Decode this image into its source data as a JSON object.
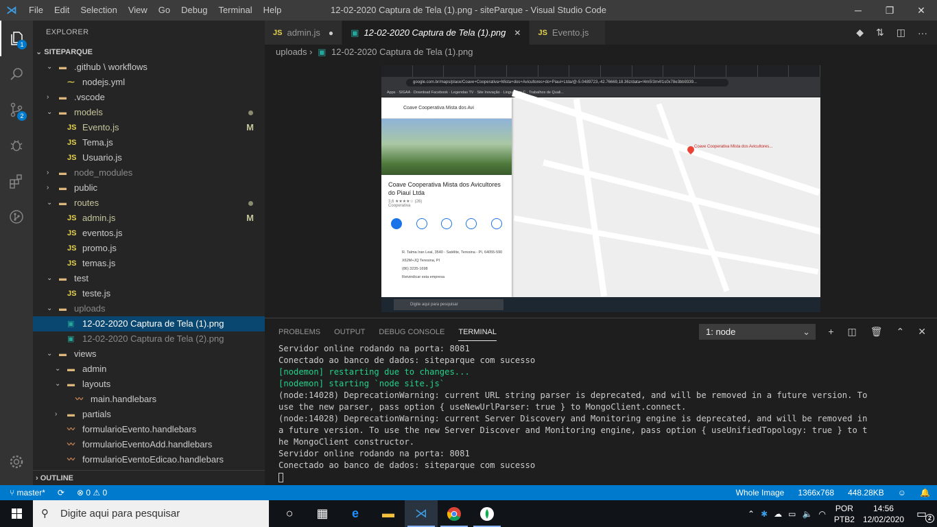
{
  "titlebar": {
    "menu": [
      "File",
      "Edit",
      "Selection",
      "View",
      "Go",
      "Debug",
      "Terminal",
      "Help"
    ],
    "title": "12-02-2020 Captura de Tela (1).png - siteParque - Visual Studio Code",
    "controls": [
      "minimize-icon",
      "restore-icon",
      "close-icon"
    ]
  },
  "activity_bar": {
    "items": [
      {
        "name": "explorer-icon",
        "badge": "1"
      },
      {
        "name": "search-icon",
        "badge": ""
      },
      {
        "name": "source-control-icon",
        "badge": "2"
      },
      {
        "name": "debug-icon",
        "badge": ""
      },
      {
        "name": "extensions-icon",
        "badge": ""
      },
      {
        "name": "git-graph-icon",
        "badge": ""
      }
    ],
    "settings_icon": "gear-icon"
  },
  "sidebar": {
    "header": "EXPLORER",
    "project": "SITEPARQUE",
    "tree": [
      {
        "label": ".github \\ workflows",
        "depth": 1,
        "type": "folder",
        "expanded": true
      },
      {
        "label": "nodejs.yml",
        "depth": 2,
        "type": "yml"
      },
      {
        "label": ".vscode",
        "depth": 1,
        "type": "folder",
        "expanded": false
      },
      {
        "label": "models",
        "depth": 1,
        "type": "folder",
        "expanded": true,
        "modified": "dot",
        "color": "#c5c59c"
      },
      {
        "label": "Evento.js",
        "depth": 2,
        "type": "js",
        "modified": "M",
        "color": "#c5c59c"
      },
      {
        "label": "Tema.js",
        "depth": 2,
        "type": "js"
      },
      {
        "label": "Usuario.js",
        "depth": 2,
        "type": "js"
      },
      {
        "label": "node_modules",
        "depth": 1,
        "type": "folder",
        "expanded": false,
        "dim": true
      },
      {
        "label": "public",
        "depth": 1,
        "type": "folder",
        "expanded": false
      },
      {
        "label": "routes",
        "depth": 1,
        "type": "folder",
        "expanded": true,
        "modified": "dot",
        "color": "#c5c59c"
      },
      {
        "label": "admin.js",
        "depth": 2,
        "type": "js",
        "modified": "M",
        "color": "#c5c59c"
      },
      {
        "label": "eventos.js",
        "depth": 2,
        "type": "js"
      },
      {
        "label": "promo.js",
        "depth": 2,
        "type": "js"
      },
      {
        "label": "temas.js",
        "depth": 2,
        "type": "js"
      },
      {
        "label": "test",
        "depth": 1,
        "type": "folder",
        "expanded": true
      },
      {
        "label": "teste.js",
        "depth": 2,
        "type": "js"
      },
      {
        "label": "uploads",
        "depth": 1,
        "type": "folder",
        "expanded": true,
        "dim": true
      },
      {
        "label": "12-02-2020 Captura de Tela (1).png",
        "depth": 2,
        "type": "img",
        "selected": true
      },
      {
        "label": "12-02-2020 Captura de Tela (2).png",
        "depth": 2,
        "type": "img",
        "dim": true
      },
      {
        "label": "views",
        "depth": 1,
        "type": "folder",
        "expanded": true
      },
      {
        "label": "admin",
        "depth": 2,
        "type": "folder",
        "expanded": true
      },
      {
        "label": "layouts",
        "depth": 2,
        "type": "folder",
        "expanded": true
      },
      {
        "label": "main.handlebars",
        "depth": 3,
        "type": "hb"
      },
      {
        "label": "partials",
        "depth": 2,
        "type": "folder",
        "expanded": false
      },
      {
        "label": "formularioEvento.handlebars",
        "depth": 2,
        "type": "hb"
      },
      {
        "label": "formularioEventoAdd.handlebars",
        "depth": 2,
        "type": "hb"
      },
      {
        "label": "formularioEventoEdicao.handlebars",
        "depth": 2,
        "type": "hb"
      }
    ],
    "outline": "OUTLINE"
  },
  "tabs": [
    {
      "label": "admin.js",
      "type": "js",
      "active": false,
      "dirty": true
    },
    {
      "label": "12-02-2020 Captura de Tela (1).png",
      "type": "img",
      "active": true
    },
    {
      "label": "Evento.js",
      "type": "js",
      "active": false
    }
  ],
  "tab_actions": [
    "compare-icon",
    "open-changes-icon",
    "split-editor-icon",
    "more-icon"
  ],
  "breadcrumb": {
    "folder": "uploads",
    "file": "12-02-2020 Captura de Tela (1).png"
  },
  "image_preview": {
    "url_text": "google.com.br/maps/place/Coave+Cooperativa+Mista+dos+Avicultores+do+Piaui+Ltda/@-5.0489723,-42.76669,18.36z/data=!4m5!3m4!1s0x78e3bb9339...",
    "search_text": "Coave Cooperativa Mista dos Avi",
    "place_name": "Coave Cooperativa Mista dos Avicultores do Piauí Ltda",
    "rating": "3,6 ★★★★☆ (26)",
    "category": "Cooperativa",
    "address": "R. Talma Iran Leal, 3540 - Satélite, Teresina - PI, 64055-590",
    "plus_code": "X62M+JQ Teresina, PI",
    "phone": "(86) 3235-1698",
    "claim": "Reivindicar esta empresa",
    "pin_label": "Coave Cooperativa Mista dos Avicultores...",
    "win_search": "Digite aqui para pesquisar"
  },
  "panel": {
    "tabs": [
      "PROBLEMS",
      "OUTPUT",
      "DEBUG CONSOLE",
      "TERMINAL"
    ],
    "active_tab": "TERMINAL",
    "terminal_selector": "1: node",
    "actions": [
      "add-icon",
      "split-icon",
      "trash-icon",
      "maximize-icon",
      "close-icon"
    ],
    "lines": [
      {
        "text": "Servidor online rodando na porta: 8081",
        "color": "default"
      },
      {
        "text": "Conectado ao banco de dados: siteparque com sucesso",
        "color": "default"
      },
      {
        "text": "[nodemon] restarting due to changes...",
        "color": "green"
      },
      {
        "text": "[nodemon] starting `node site.js`",
        "color": "green"
      },
      {
        "text": "(node:14028) DeprecationWarning: current URL string parser is deprecated, and will be removed in a future version. To use the new parser, pass option { useNewUrlParser: true } to MongoClient.connect.",
        "color": "default"
      },
      {
        "text": "(node:14028) DeprecationWarning: current Server Discovery and Monitoring engine is deprecated, and will be removed in a future version. To use the new Server Discover and Monitoring engine, pass option { useUnifiedTopology: true } to the MongoClient constructor.",
        "color": "default"
      },
      {
        "text": "Servidor online rodando na porta: 8081",
        "color": "default"
      },
      {
        "text": "Conectado ao banco de dados: siteparque com sucesso",
        "color": "default"
      }
    ]
  },
  "statusbar": {
    "branch": "master*",
    "sync": "sync-icon",
    "errors": "0",
    "warnings": "0",
    "image_type": "Whole Image",
    "dimensions": "1366x768",
    "size": "448.28KB",
    "right_icons": [
      "feedback-icon",
      "bell-icon"
    ]
  },
  "taskbar": {
    "search_placeholder": "Digite aqui para pesquisar",
    "apps": [
      "task-view-icon",
      "timeline-icon",
      "edge-icon",
      "file-explorer-icon",
      "vscode-icon",
      "chrome-icon",
      "mongodb-icon"
    ],
    "lang_top": "POR",
    "lang_bottom": "PTB2",
    "time": "14:56",
    "date": "12/02/2020",
    "notifications": "2"
  }
}
